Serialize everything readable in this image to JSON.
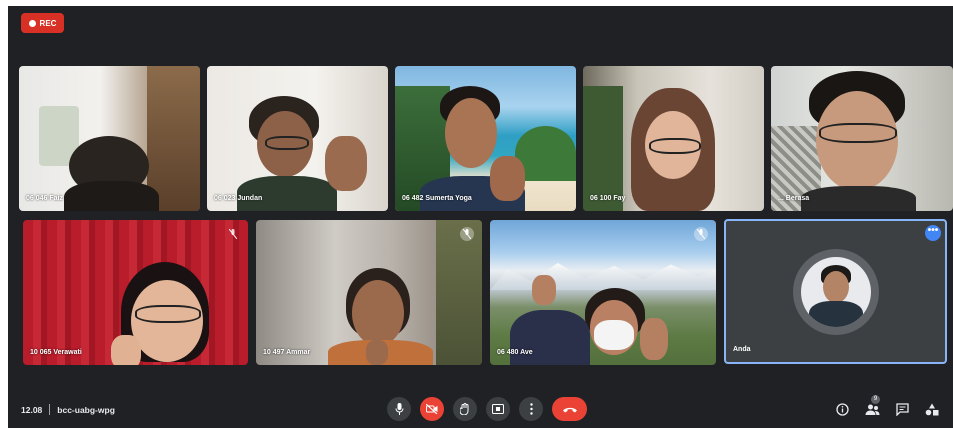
{
  "recording": {
    "label": "REC"
  },
  "participants": [
    {
      "name": "06 046 Faiz"
    },
    {
      "name": "06 023 Jundan"
    },
    {
      "name": "06 482 Sumerta Yoga"
    },
    {
      "name": "06 100 Fay"
    },
    {
      "name": "... Berasa"
    },
    {
      "name": "10 065 Verawati"
    },
    {
      "name": "10 497 Ammar"
    },
    {
      "name": "06 480 Ave"
    },
    {
      "name": "Anda"
    }
  ],
  "bottom_bar": {
    "time": "12.08",
    "meeting_code": "bcc-uabg-wpg",
    "participant_count": "9"
  },
  "icons": {
    "mic": "microphone-icon",
    "camera_off": "camera-off-icon",
    "raise_hand": "hand-icon",
    "present": "present-screen-icon",
    "more": "more-options-icon",
    "end_call": "end-call-icon",
    "info": "info-icon",
    "people": "people-icon",
    "chat": "chat-icon",
    "activities": "activities-icon"
  },
  "colors": {
    "background": "#202124",
    "rec": "#d93025",
    "control": "#3c4043",
    "danger": "#ea4335",
    "self_border": "#8ab4f8"
  }
}
